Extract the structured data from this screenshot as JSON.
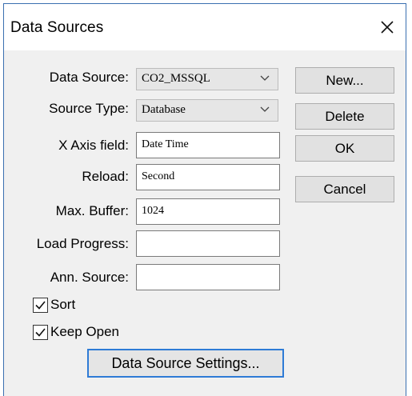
{
  "window": {
    "title": "Data Sources"
  },
  "icons": {
    "close": "close-icon",
    "dropdown": "chevron-down-icon",
    "check": "checkmark-icon"
  },
  "form": {
    "data_source": {
      "label": "Data Source:",
      "value": "CO2_MSSQL"
    },
    "source_type": {
      "label": "Source Type:",
      "value": "Database"
    },
    "x_axis_field": {
      "label": "X Axis field:",
      "value": "Date Time"
    },
    "reload": {
      "label": "Reload:",
      "value": "Second"
    },
    "max_buffer": {
      "label": "Max. Buffer:",
      "value": "1024"
    },
    "load_progress": {
      "label": "Load Progress:",
      "value": ""
    },
    "ann_source": {
      "label": "Ann. Source:",
      "value": ""
    }
  },
  "checkboxes": {
    "sort": {
      "label": "Sort",
      "checked": true
    },
    "keep_open": {
      "label": "Keep Open",
      "checked": true
    }
  },
  "buttons": {
    "new": "New...",
    "delete": "Delete",
    "ok": "OK",
    "cancel": "Cancel",
    "settings": "Data Source Settings..."
  }
}
